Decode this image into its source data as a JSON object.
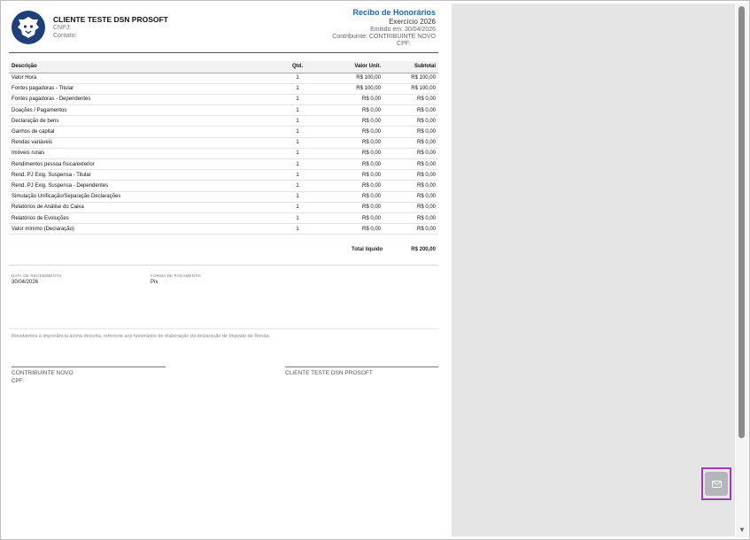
{
  "company": {
    "name": "CLIENTE TESTE DSN PROSOFT",
    "cnpj_label": "CNPJ:",
    "contact_label": "Contato:"
  },
  "receipt": {
    "title": "Recibo de Honorários",
    "year": "Exercício 2026",
    "issued": "Emitido em: 30/04/2026",
    "taxpayer": "Contribuinte: CONTRIBUINTE NOVO",
    "cpf": "CPF:"
  },
  "table": {
    "headers": {
      "desc": "Descrição",
      "qty": "Qtd.",
      "unit": "Valor Unit.",
      "subtotal": "Subtotal"
    },
    "rows": [
      {
        "desc": "Valor Hora",
        "qty": "1",
        "unit": "R$ 100,00",
        "subtotal": "R$ 100,00"
      },
      {
        "desc": "Fontes pagadoras - Titular",
        "qty": "1",
        "unit": "R$ 100,00",
        "subtotal": "R$ 100,00"
      },
      {
        "desc": "Fontes pagadoras - Dependentes",
        "qty": "1",
        "unit": "R$ 0,00",
        "subtotal": "R$ 0,00"
      },
      {
        "desc": "Doações / Pagamentos",
        "qty": "1",
        "unit": "R$ 0,00",
        "subtotal": "R$ 0,00"
      },
      {
        "desc": "Declaração de bens",
        "qty": "1",
        "unit": "R$ 0,00",
        "subtotal": "R$ 0,00"
      },
      {
        "desc": "Ganhos de capital",
        "qty": "1",
        "unit": "R$ 0,00",
        "subtotal": "R$ 0,00"
      },
      {
        "desc": "Rendas variáveis",
        "qty": "1",
        "unit": "R$ 0,00",
        "subtotal": "R$ 0,00"
      },
      {
        "desc": "Imóveis rurais",
        "qty": "1",
        "unit": "R$ 0,00",
        "subtotal": "R$ 0,00"
      },
      {
        "desc": "Rendimentos pessoa física/exterior",
        "qty": "1",
        "unit": "R$ 0,00",
        "subtotal": "R$ 0,00"
      },
      {
        "desc": "Rend. PJ Exig. Suspensa - Titular",
        "qty": "1",
        "unit": "R$ 0,00",
        "subtotal": "R$ 0,00"
      },
      {
        "desc": "Rend. PJ Exig. Suspensa - Dependentes",
        "qty": "1",
        "unit": "R$ 0,00",
        "subtotal": "R$ 0,00"
      },
      {
        "desc": "Simulação Unificação/Separação Declarações",
        "qty": "1",
        "unit": "R$ 0,00",
        "subtotal": "R$ 0,00"
      },
      {
        "desc": "Relatórios de Análise do Caixa",
        "qty": "1",
        "unit": "R$ 0,00",
        "subtotal": "R$ 0,00"
      },
      {
        "desc": "Relatórios de Evoluções",
        "qty": "1",
        "unit": "R$ 0,00",
        "subtotal": "R$ 0,00"
      },
      {
        "desc": "Valor mínimo (Declaração)",
        "qty": "1",
        "unit": "R$ 0,00",
        "subtotal": "R$ 0,00"
      }
    ]
  },
  "totals": {
    "label": "Total líquido",
    "value": "R$ 200,00"
  },
  "payment": {
    "date_label": "DATA DE RECEBIMENTO",
    "date_value": "30/04/2026",
    "method_label": "FORMA DE PAGAMENTO",
    "method_value": "Pix"
  },
  "declaration": "Recebemos a importância acima descrita, referente aos honorários de elaboração da declaração de Imposto de Renda.",
  "signatures": {
    "left_name": "CONTRIBUINTE NOVO",
    "left_cpf": "CPF:",
    "right_name": "CLIENTE TESTE DSN PROSOFT"
  },
  "colors": {
    "brand": "#1e3f7a",
    "title": "#1f63b8",
    "highlight": "#a03bb3"
  },
  "icons": {
    "logo": "lion-head-logo",
    "mail": "envelope-icon",
    "scroll": "scroll-down-icon"
  }
}
